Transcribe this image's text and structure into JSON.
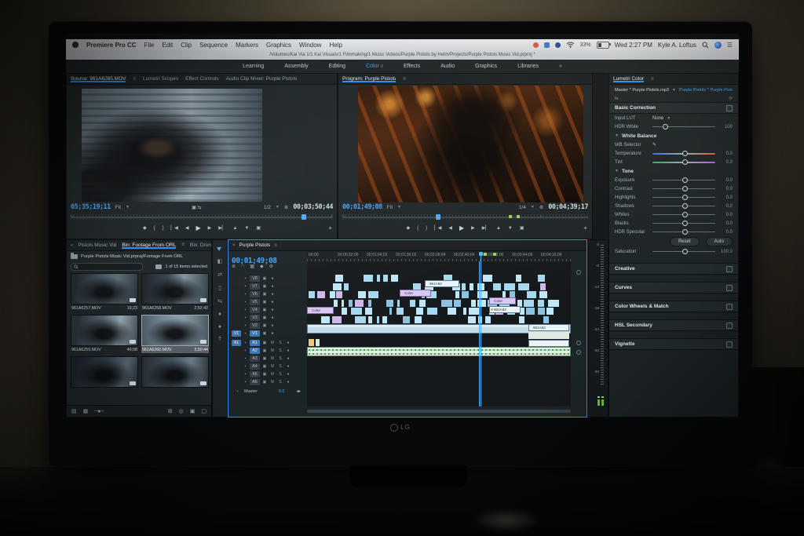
{
  "window": {
    "brand": "LG"
  },
  "menu_bar": {
    "app_name": "Premiere Pro CC",
    "menus": [
      "File",
      "Edit",
      "Clip",
      "Sequence",
      "Markers",
      "Graphics",
      "Window",
      "Help"
    ],
    "battery_pct": "33%",
    "clock": "Wed 2:27 PM",
    "user": "Kyle A. Loftus"
  },
  "title_bar": {
    "path": "/Volumes/Kai Via 1/1 Kai Visuals/1 Filmmaking/1 Music Videos/Purple Pistols by Helm/Projects/Purple Pistols Music Vid.prproj *"
  },
  "workspace": {
    "tabs": [
      "Learning",
      "Assembly",
      "Editing",
      "Color",
      "Effects",
      "Audio",
      "Graphics",
      "Libraries"
    ],
    "active": "Color",
    "overflow": "»"
  },
  "source_monitor": {
    "tabs": [
      {
        "label": "Source: 961A6265.MOV",
        "active": true
      },
      {
        "label": "Lumetri Scopes",
        "active": false
      },
      {
        "label": "Effect Controls",
        "active": false
      },
      {
        "label": "Audio Clip Mixer: Purple Pistols",
        "active": false
      }
    ],
    "current_time": "05;35;19;11",
    "fit": "Fit",
    "zoom_level": "1/2",
    "duration": "00;03;50;44"
  },
  "program_monitor": {
    "tab": "Program: Purple Pistols",
    "current_time": "00;01;49;08",
    "fit": "Fit",
    "zoom_level": "1/4",
    "duration": "00;04;39;17"
  },
  "lumetri": {
    "title": "Lumetri Color",
    "master_label": "Master * Purple Pistols.mp3",
    "sequence_label": "Purple Pistols * Purple Pistols.m...",
    "basic_correction": "Basic Correction",
    "input_lut_label": "Input LUT",
    "input_lut_value": "None",
    "hdr_white": {
      "label": "HDR White",
      "value": "100"
    },
    "white_balance": "White Balance",
    "wb_selector": "WB Selector",
    "wb_sliders": [
      {
        "label": "Temperature",
        "value": "0.0",
        "grad": "temp"
      },
      {
        "label": "Tint",
        "value": "0.0",
        "grad": "tint"
      }
    ],
    "tone": "Tone",
    "tone_sliders": [
      {
        "label": "Exposure",
        "value": "0.0"
      },
      {
        "label": "Contrast",
        "value": "0.0"
      },
      {
        "label": "Highlights",
        "value": "0.0"
      },
      {
        "label": "Shadows",
        "value": "0.0"
      },
      {
        "label": "Whites",
        "value": "0.0"
      },
      {
        "label": "Blacks",
        "value": "0.0"
      },
      {
        "label": "HDR Specular",
        "value": "0.0"
      }
    ],
    "reset": "Reset",
    "auto": "Auto",
    "saturation": {
      "label": "Saturation",
      "value": "100.0"
    },
    "sections": [
      "Creative",
      "Curves",
      "Color Wheels & Match",
      "HSL Secondary",
      "Vignette"
    ]
  },
  "project": {
    "tabs": [
      {
        "label": "Pistols Music Vid",
        "active": false
      },
      {
        "label": "Bin: Footage From ORL",
        "active": true
      },
      {
        "label": "Bin: Drone Fox",
        "active": false
      }
    ],
    "overflow": "»",
    "path": "Purple Pistols Music Vid.prproj/Footage From ORL",
    "status": "1 of 15 items selected",
    "clips": [
      {
        "name": "961A6257.MOV",
        "duration": "19;23",
        "selected": false
      },
      {
        "name": "961A6258.MOV",
        "duration": "2;52;42",
        "selected": false
      },
      {
        "name": "961A6259.MOV",
        "duration": "49;58",
        "selected": false
      },
      {
        "name": "961A6260.MOV",
        "duration": "3;50;44",
        "selected": true
      },
      {
        "name": "",
        "duration": "",
        "selected": false
      },
      {
        "name": "",
        "duration": "",
        "selected": false
      }
    ]
  },
  "timeline": {
    "tab": "Purple Pistols",
    "current_time": "00;01;49;08",
    "ruler": [
      "00;00",
      "00;00;32;00",
      "00;01;04;02",
      "00;01;36;02",
      "00;02;08;04",
      "00;02;40;04",
      "00;03;12;06",
      "00;03;44;06",
      "00;04;16;08"
    ],
    "video_tracks": [
      "V8",
      "V7",
      "V6",
      "V5",
      "V4",
      "V3",
      "V2",
      "V1"
    ],
    "audio_tracks": [
      "A1",
      "A2",
      "A3",
      "A4",
      "A5",
      "A6"
    ],
    "source_patch_video": "V1",
    "source_patch_audio": "A1",
    "master_label": "Master",
    "master_db": "0.0",
    "clip_labels": {
      "adjustment": "Color",
      "video": "961A62"
    }
  },
  "audio_meter": {
    "db_labels": [
      "0",
      "-6",
      "-12",
      "-18",
      "-24",
      "-30",
      "-36"
    ]
  },
  "colors": {
    "accent_blue": "#2d8ceb",
    "timecode_blue": "#3ea4f7",
    "marker_green": "#a9cf4a"
  }
}
